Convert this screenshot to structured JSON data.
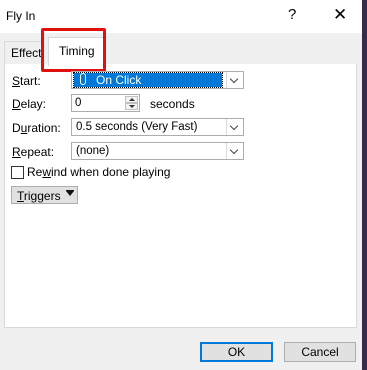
{
  "window": {
    "title": "Fly In",
    "help": "?",
    "close": "✕"
  },
  "tabs": [
    {
      "label": "Effect"
    },
    {
      "label": "Timing"
    }
  ],
  "fields": {
    "start": {
      "label_u": "S",
      "label_rest": "tart:",
      "value": "On Click"
    },
    "delay": {
      "label_u": "D",
      "label_rest": "elay:",
      "value": "0",
      "unit": "seconds"
    },
    "duration": {
      "label_pre": "D",
      "label_u": "u",
      "label_rest": "ration:",
      "value": "0.5 seconds (Very Fast)"
    },
    "repeat": {
      "label_u": "R",
      "label_rest": "epeat:",
      "value": "(none)"
    },
    "rewind": {
      "label_pre": "Re",
      "label_u": "w",
      "label_rest": "ind when done playing",
      "checked": false
    }
  },
  "triggers": {
    "label_u": "T",
    "label_rest": "riggers"
  },
  "buttons": {
    "ok": "OK",
    "cancel": "Cancel"
  },
  "colors": {
    "highlight": "#e01010",
    "selection": "#0078d7",
    "default_border": "#0078d7"
  },
  "icons": {
    "dropdown": "chevron-down-icon",
    "spinner": "spin-arrows-icon",
    "triggers": "double-chevron-down-icon"
  }
}
